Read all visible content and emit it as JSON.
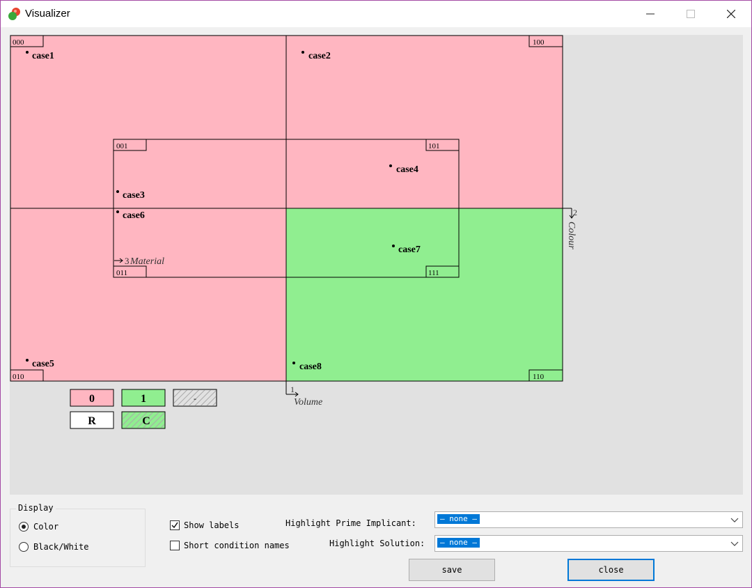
{
  "window": {
    "title": "Visualizer"
  },
  "colors": {
    "false_region": "#ffb6c1",
    "true_region": "#90ee90",
    "canvas_bg": "#e1e1e1",
    "accent": "#0078d7"
  },
  "diagram": {
    "regions": [
      {
        "code": "000",
        "value": "0"
      },
      {
        "code": "100",
        "value": "0"
      },
      {
        "code": "010",
        "value": "0"
      },
      {
        "code": "110",
        "value": "1"
      },
      {
        "code": "001",
        "value": "0"
      },
      {
        "code": "101",
        "value": "0"
      },
      {
        "code": "011",
        "value": "0"
      },
      {
        "code": "111",
        "value": "1"
      }
    ],
    "cases": [
      "case1",
      "case2",
      "case3",
      "case4",
      "case5",
      "case6",
      "case7",
      "case8"
    ],
    "axes": {
      "x": {
        "number": "1",
        "name": "Volume"
      },
      "y": {
        "number": "2",
        "name": "Colour"
      },
      "z": {
        "number": "3",
        "name": "Material"
      }
    },
    "legend": [
      {
        "label": "0",
        "fill": "#ffb6c1",
        "hatched": false
      },
      {
        "label": "1",
        "fill": "#90ee90",
        "hatched": false
      },
      {
        "label": "-",
        "fill": "#e1e1e1",
        "hatched": true
      },
      {
        "label": "R",
        "fill": "#ffffff",
        "hatched": false
      },
      {
        "label": "C",
        "fill": "#90ee90",
        "hatched": true
      }
    ]
  },
  "display": {
    "group_label": "Display",
    "options": [
      {
        "label": "Color",
        "selected": true
      },
      {
        "label": "Black/White",
        "selected": false
      }
    ]
  },
  "options": {
    "show_labels": {
      "label": "Show labels",
      "checked": true
    },
    "short_names": {
      "label": "Short condition names",
      "checked": false
    }
  },
  "highlight": {
    "prime_label": "Highlight Prime Implicant:",
    "prime_value": "— none —",
    "solution_label": "Highlight Solution:",
    "solution_value": "— none —"
  },
  "buttons": {
    "save": "save",
    "close": "close"
  }
}
